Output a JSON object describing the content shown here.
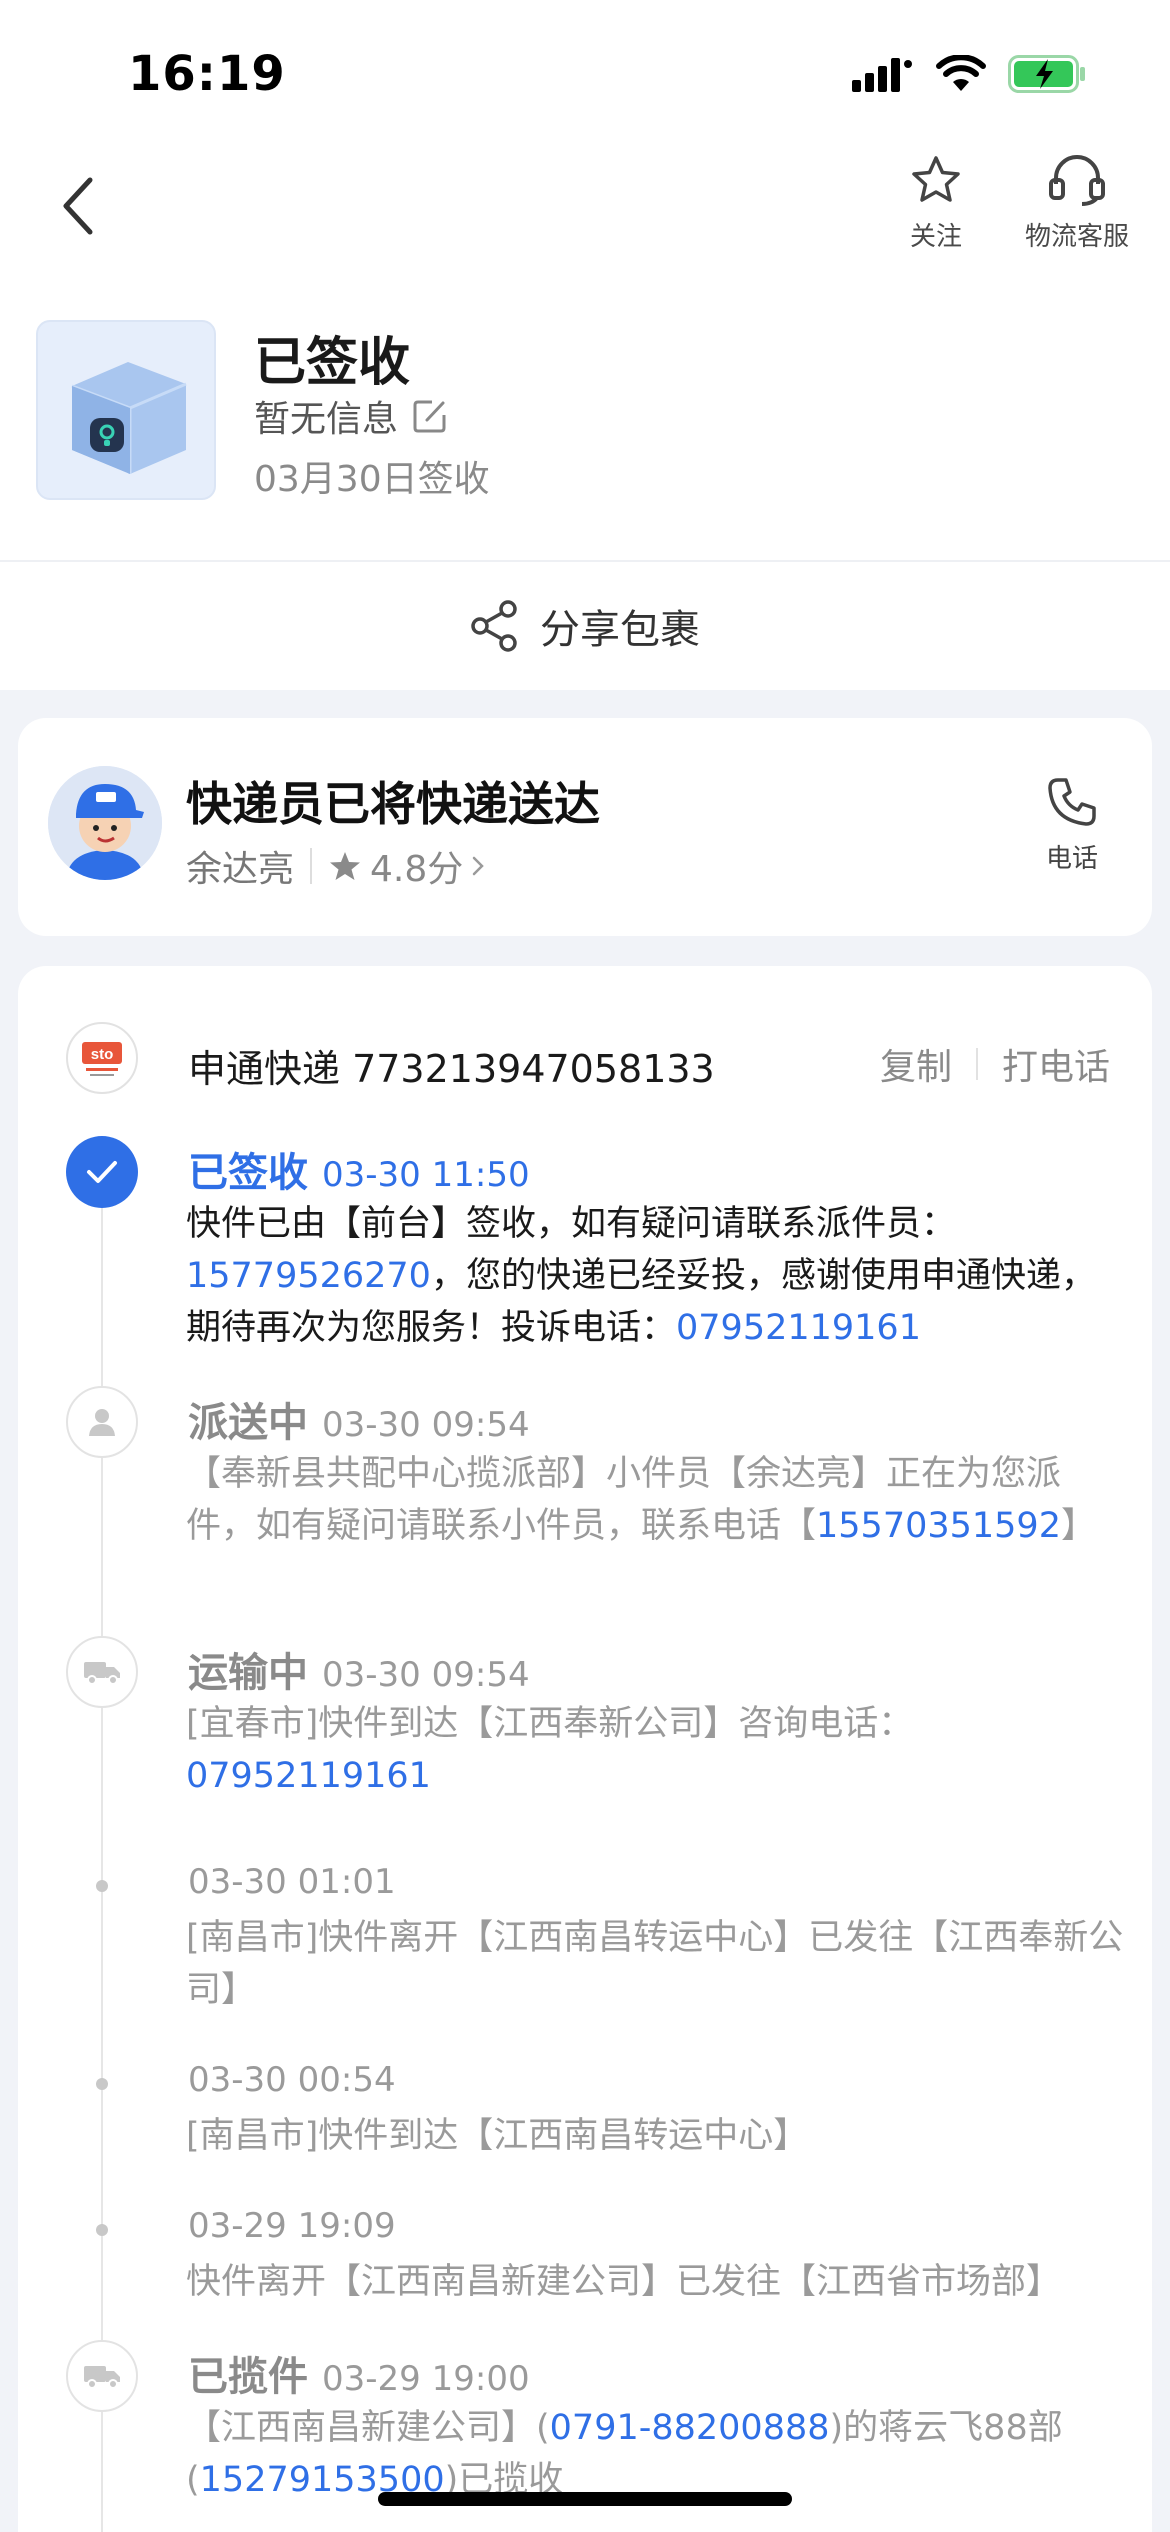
{
  "status_bar": {
    "time": "16:19"
  },
  "nav": {
    "follow_label": "关注",
    "service_label": "物流客服"
  },
  "package": {
    "status": "已签收",
    "note": "暂无信息",
    "signed_date": "03月30日签收"
  },
  "share": {
    "label": "分享包裹"
  },
  "courier": {
    "title": "快递员已将快递送达",
    "name": "余达亮",
    "rating": "4.8分",
    "phone_label": "电话"
  },
  "carrier": {
    "name_and_number": "申通快递 773213947058133",
    "copy_label": "复制",
    "call_label": "打电话"
  },
  "timeline": [
    {
      "status": "已签收",
      "time": "03-30 11:50",
      "desc_a": "快件已由【前台】签收，如有疑问请联系派件员：",
      "link_a": "15779526270",
      "desc_b": "，您的快递已经妥投，感谢使用申通快递，期待再次为您服务！投诉电话：",
      "link_b": "07952119161"
    },
    {
      "status": "派送中",
      "time": "03-30 09:54",
      "desc_a": "【奉新县共配中心揽派部】小件员【余达亮】正在为您派件，如有疑问请联系小件员，联系电话【",
      "link_a": "15570351592",
      "desc_b": "】"
    },
    {
      "status": "运输中",
      "time": "03-30 09:54",
      "desc_a": "[宜春市]快件到达【江西奉新公司】咨询电话：",
      "link_a": "07952119161"
    },
    {
      "time": "03-30 01:01",
      "desc_a": "[南昌市]快件离开【江西南昌转运中心】已发往【江西奉新公司】"
    },
    {
      "time": "03-30 00:54",
      "desc_a": "[南昌市]快件到达【江西南昌转运中心】"
    },
    {
      "time": "03-29 19:09",
      "desc_a": "快件离开【江西南昌新建公司】已发往【江西省市场部】"
    },
    {
      "status": "已揽件",
      "time": "03-29 19:00",
      "desc_a": "【江西南昌新建公司】(",
      "link_a": "0791-88200888",
      "desc_b": ")的蒋云飞88部(",
      "link_b": "15279153500",
      "desc_c": ")已揽收"
    }
  ],
  "colors": {
    "accent": "#2f6fe6",
    "battery": "#34c759"
  },
  "icons": [
    "back-chevron-icon",
    "star-icon",
    "headset-icon",
    "edit-icon",
    "share-icon",
    "star-rating-icon",
    "phone-icon",
    "check-icon",
    "person-icon",
    "truck-icon"
  ]
}
